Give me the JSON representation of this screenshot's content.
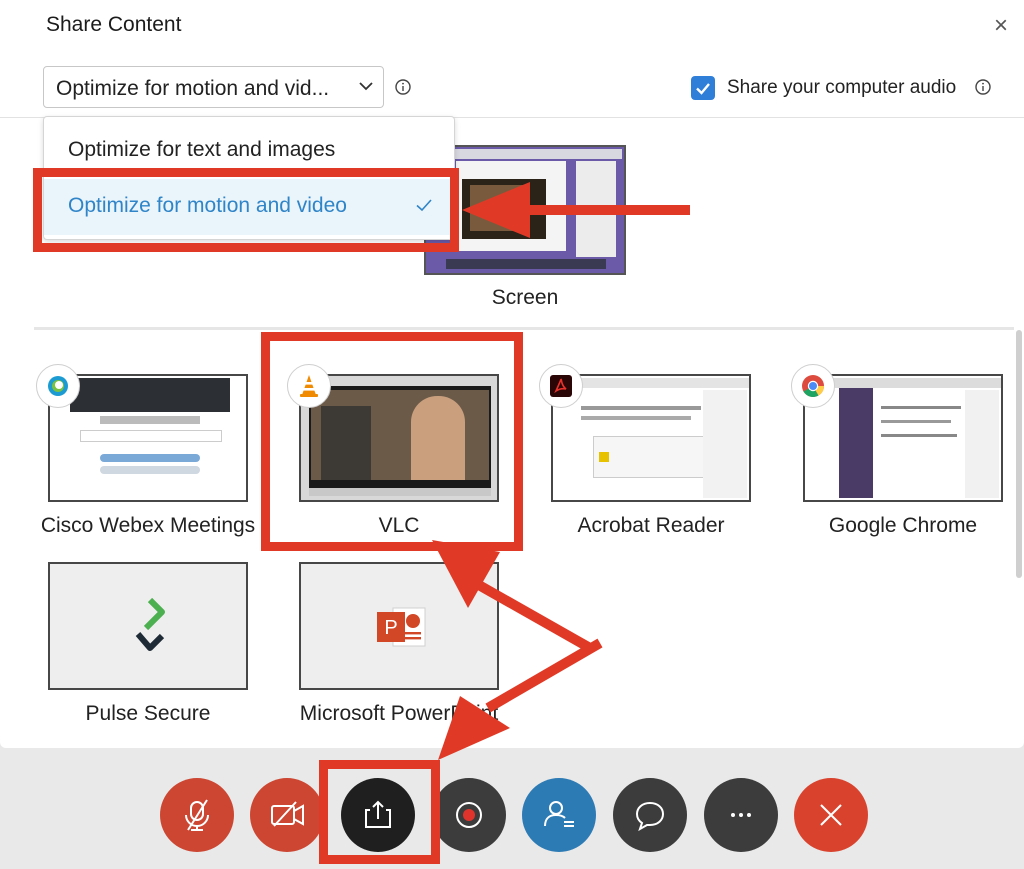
{
  "dialog": {
    "title": "Share Content",
    "close": "×",
    "optimize_select": {
      "value": "Optimize for motion and vid...",
      "expanded": true
    },
    "audio": {
      "label": "Share your computer audio",
      "checked": true
    },
    "dropdown_options": [
      {
        "label": "Optimize for text and images",
        "selected": false
      },
      {
        "label": "Optimize for motion and video",
        "selected": true
      }
    ],
    "screen": {
      "label": "Screen"
    },
    "apps": [
      {
        "label": "Cisco Webex Meetings",
        "icon": "webex-icon"
      },
      {
        "label": "VLC",
        "icon": "vlc-cone-icon"
      },
      {
        "label": "Acrobat Reader",
        "icon": "acrobat-icon"
      },
      {
        "label": "Google Chrome",
        "icon": "chrome-icon"
      },
      {
        "label": "Pulse Secure",
        "icon": "pulse-secure-icon"
      },
      {
        "label": "Microsoft PowerPoint",
        "icon": "powerpoint-icon"
      }
    ]
  },
  "toolbar": {
    "buttons": [
      {
        "name": "mute",
        "icon": "microphone-muted-icon"
      },
      {
        "name": "video",
        "icon": "camera-off-icon"
      },
      {
        "name": "share",
        "icon": "share-upload-icon",
        "active": true
      },
      {
        "name": "record",
        "icon": "record-icon"
      },
      {
        "name": "participants",
        "icon": "participants-icon"
      },
      {
        "name": "chat",
        "icon": "chat-bubble-icon"
      },
      {
        "name": "more",
        "icon": "more-options-icon"
      },
      {
        "name": "end",
        "icon": "close-x-icon"
      }
    ]
  },
  "colors": {
    "accent": "#2f7ed8",
    "annotation_red": "#e03a27",
    "mute_red": "#cc4632",
    "share_black": "#1f1f1f",
    "participants_blue": "#2d7bb5",
    "dark_button": "#3c3c3c",
    "end_red": "#d9432e"
  }
}
